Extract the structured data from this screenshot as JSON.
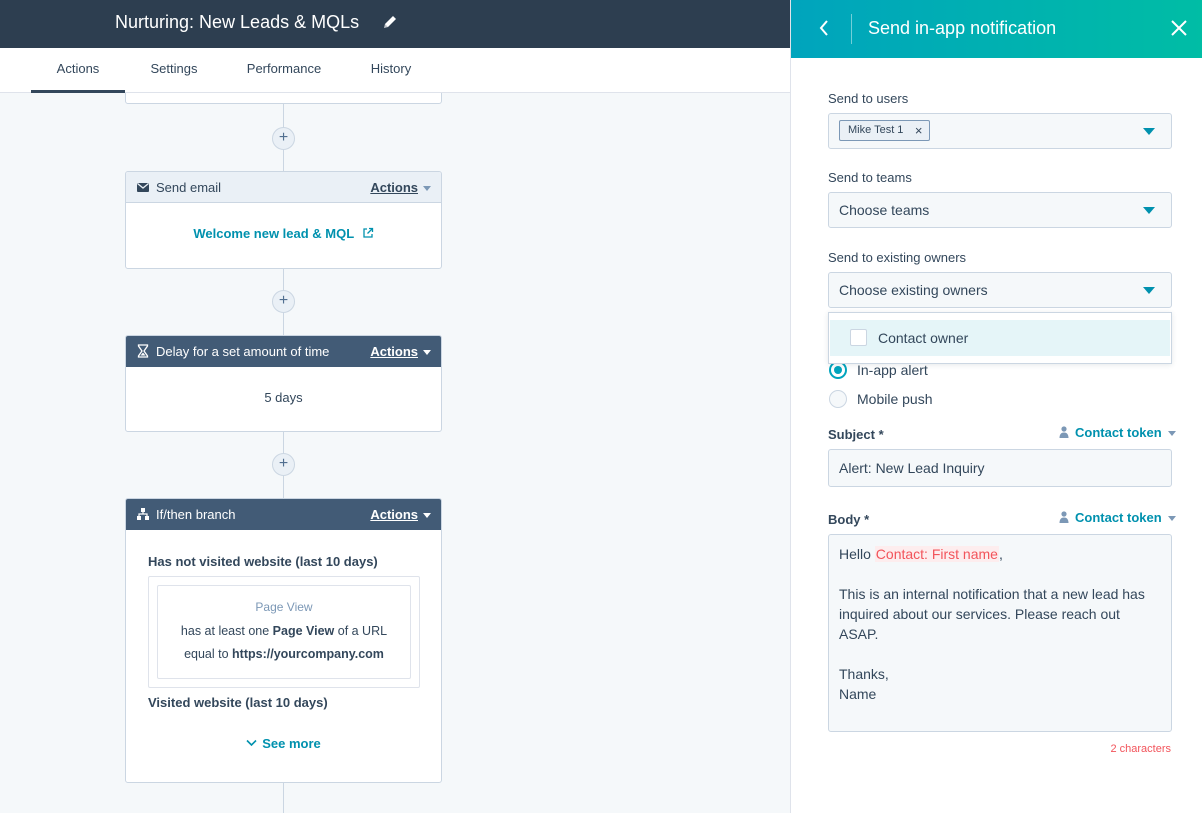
{
  "header": {
    "title": "Nurturing: New Leads & MQLs",
    "edit_icon": "pencil-icon"
  },
  "tabs": [
    {
      "label": "Actions",
      "active": true
    },
    {
      "label": "Settings",
      "active": false
    },
    {
      "label": "Performance",
      "active": false
    },
    {
      "label": "History",
      "active": false
    }
  ],
  "workflow": {
    "add_symbol": "+",
    "send_email": {
      "title": "Send email",
      "actions_label": "Actions",
      "email_name": "Welcome new lead & MQL",
      "icon": "envelope-icon"
    },
    "delay": {
      "title": "Delay for a set amount of time",
      "actions_label": "Actions",
      "value": "5 days",
      "icon": "hourglass-icon"
    },
    "branch": {
      "title": "If/then branch",
      "actions_label": "Actions",
      "icon": "branch-icon",
      "branch1_label": "Has not visited website (last 10 days)",
      "filter_type": "Page View",
      "filter_pre": "has at least one ",
      "filter_bold": "Page View",
      "filter_mid": " of a URL",
      "filter_line2_pre": "equal to ",
      "filter_url": "https://yourcompany.com",
      "branch2_label": "Visited website (last 10 days)",
      "see_more": "See more"
    }
  },
  "panel": {
    "title": "Send in-app notification",
    "send_to_users": {
      "label": "Send to users",
      "chip": "Mike Test 1",
      "chip_remove": "×"
    },
    "send_to_teams": {
      "label": "Send to teams",
      "placeholder": "Choose teams"
    },
    "send_to_owners": {
      "label": "Send to existing owners",
      "placeholder": "Choose existing owners"
    },
    "owner_options": [
      {
        "label": "Contact owner",
        "checked": false
      }
    ],
    "delivery": [
      {
        "label": "In-app alert",
        "selected": true
      },
      {
        "label": "Mobile push",
        "selected": false
      }
    ],
    "subject": {
      "label": "Subject *",
      "token_label": "Contact token",
      "value": "Alert: New Lead Inquiry"
    },
    "body": {
      "label": "Body *",
      "token_label": "Contact token",
      "greeting": "Hello ",
      "token": "Contact: First name",
      "greeting_end": ",",
      "line1": "This is an internal notification that a new lead has inquired about our services. Please reach out ASAP.",
      "sign1": "Thanks,",
      "sign2": "Name",
      "char_count": "2 characters"
    }
  },
  "colors": {
    "topbar": "#2d3e50",
    "accent": "#00a4bd",
    "accent_end": "#00bda5",
    "link": "#0091ae",
    "token_red": "#f2545b"
  }
}
